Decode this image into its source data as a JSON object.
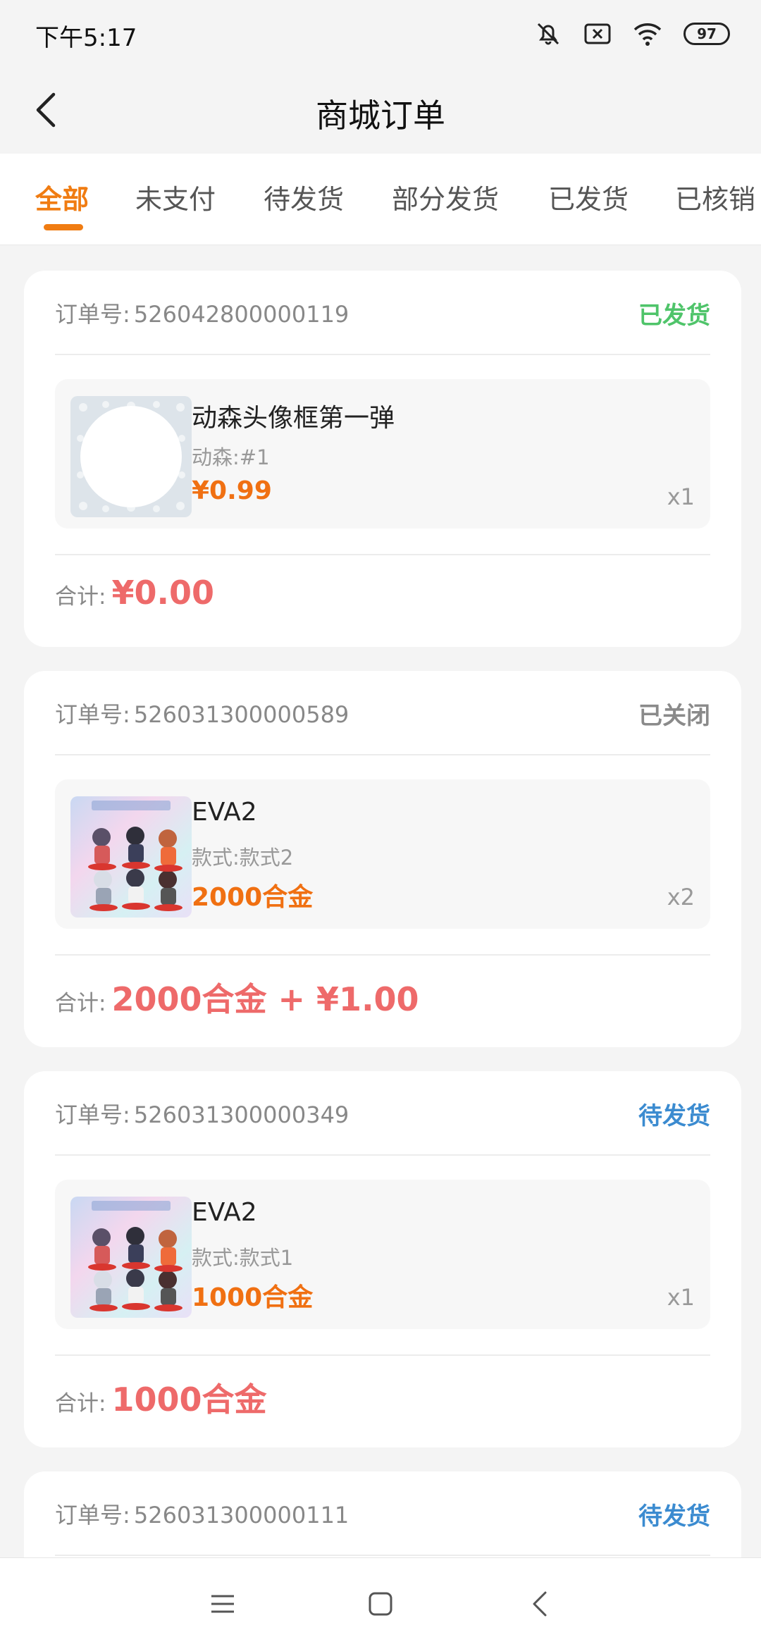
{
  "status_bar": {
    "time": "下午5:17",
    "icons": [
      "bell-muted-icon",
      "close-box-icon",
      "wifi-icon",
      "battery-icon"
    ],
    "battery": "97"
  },
  "header": {
    "title": "商城订单",
    "back_icon": "back-arrow-icon"
  },
  "tabs": [
    {
      "label": "全部",
      "active": true
    },
    {
      "label": "未支付",
      "active": false
    },
    {
      "label": "待发货",
      "active": false
    },
    {
      "label": "部分发货",
      "active": false
    },
    {
      "label": "已发货",
      "active": false
    },
    {
      "label": "已核销",
      "active": false
    }
  ],
  "colors": {
    "accent": "#f07c12",
    "shipped": "#4fc46a",
    "closed": "#8a8a8a",
    "pending": "#3b8bd0",
    "total": "#ee6a6a"
  },
  "orders": [
    {
      "order_label": "订单号:",
      "order_no": "526042800000119",
      "status": "已发货",
      "item": {
        "name": "动森头像框第一弹",
        "spec": "动森:#1",
        "price": "¥0.99",
        "qty": "x1"
      },
      "total_label": "合计:",
      "total": "¥0.00"
    },
    {
      "order_label": "订单号:",
      "order_no": "526031300000589",
      "status": "已关闭",
      "item": {
        "name": "EVA2",
        "spec": "款式:款式2",
        "price": "2000合金",
        "qty": "x2"
      },
      "total_label": "合计:",
      "total": "2000合金 + ¥1.00"
    },
    {
      "order_label": "订单号:",
      "order_no": "526031300000349",
      "status": "待发货",
      "item": {
        "name": "EVA2",
        "spec": "款式:款式1",
        "price": "1000合金",
        "qty": "x1"
      },
      "total_label": "合计:",
      "total": "1000合金"
    },
    {
      "order_label": "订单号:",
      "order_no": "526031300000111",
      "status": "待发货"
    }
  ],
  "nav_bar": {
    "icons": [
      "menu-icon",
      "home-square-icon",
      "back-triangle-icon"
    ]
  }
}
